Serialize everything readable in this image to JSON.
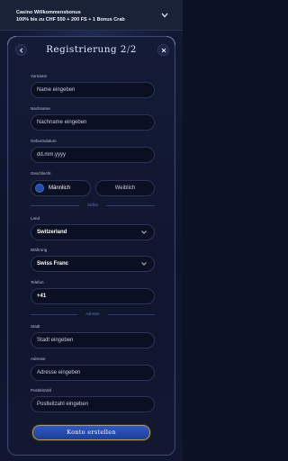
{
  "banner": {
    "line1": "Casino Willkommensbonus",
    "line2": "100% bis zu CHF 550 + 200 FS + 1 Bonus Crab"
  },
  "header": {
    "title_main": "Registrierung 2",
    "title_sep": "/",
    "title_total": "2"
  },
  "form": {
    "first_name": {
      "label": "Vorname",
      "placeholder": "Name eingeben"
    },
    "last_name": {
      "label": "Nachname",
      "placeholder": "Nachname eingeben"
    },
    "birthdate": {
      "label": "Geburtsdatum",
      "placeholder": "dd.mm.yyyy"
    },
    "gender": {
      "label": "Geschlecht",
      "options": [
        "Männlich",
        "Weiblich"
      ],
      "selected": "Männlich"
    },
    "security_divider": "Sicher",
    "country": {
      "label": "Land",
      "value": "Switzerland"
    },
    "currency": {
      "label": "Währung",
      "value": "Swiss Franc"
    },
    "phone": {
      "label": "Telefon",
      "value": "+41"
    },
    "address_divider": "Adresse",
    "city": {
      "label": "Stadt",
      "placeholder": "Stadt eingeben"
    },
    "address": {
      "label": "Adresse",
      "placeholder": "Adresse eingeben"
    },
    "zip": {
      "label": "Postleitzahl",
      "placeholder": "Postleitzahl eingeben"
    }
  },
  "submit_label": "Konto erstellen",
  "colors": {
    "accent": "#2f59c4",
    "gold_border": "#b99852",
    "background": "#0c1226"
  }
}
